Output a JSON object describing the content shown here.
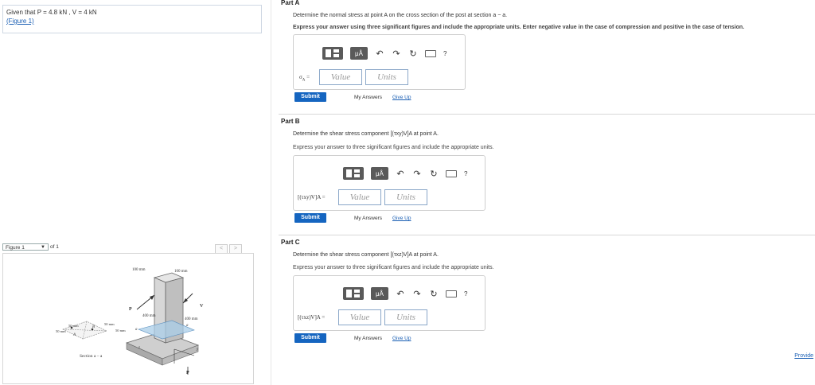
{
  "given": {
    "text_prefix": "Given that",
    "p_expr": "P = 4.8 kN , V = 4 kN",
    "figure_link": "(Figure 1)"
  },
  "parts": [
    {
      "title": "Part A",
      "question": "Determine the normal stress at point A on the cross section of the post at section a − a.",
      "instruction": "Express your answer using three significant figures and include the appropriate units. Enter negative value in the case of compression and positive in the case of tension.",
      "var_label": "σ",
      "var_sub": "A",
      "value_placeholder": "Value",
      "units_placeholder": "Units",
      "submit_label": "Submit",
      "my_answers": "My Answers",
      "give_up": "Give Up"
    },
    {
      "title": "Part B",
      "question": "Determine the shear stress component [(τxy)V]A at point A.",
      "instruction": "Express your answer to three significant figures and include the appropriate units.",
      "var_label": "[(τxy)V]A =",
      "value_placeholder": "Value",
      "units_placeholder": "Units",
      "submit_label": "Submit",
      "my_answers": "My Answers",
      "give_up": "Give Up"
    },
    {
      "title": "Part C",
      "question": "Determine the shear stress component [(τxz)V]A at point A.",
      "instruction": "Express your answer to three significant figures and include the appropriate units.",
      "var_label": "[(τxz)V]A =",
      "value_placeholder": "Value",
      "units_placeholder": "Units",
      "submit_label": "Submit",
      "my_answers": "My Answers",
      "give_up": "Give Up"
    }
  ],
  "toolbar": {
    "mu_label": "μÅ",
    "help_label": "?"
  },
  "figure_panel": {
    "selected": "Figure 1",
    "of_text": "of 1",
    "prev": "<",
    "next": ">",
    "labels": {
      "dim_top_left": "100 mm",
      "dim_top_right": "100 mm",
      "p_top": "P",
      "v_label": "V",
      "dim_400_left": "400 mm",
      "dim_400_right": "400 mm",
      "a_left": "a",
      "a_right": "a",
      "z_label": "z",
      "y_label": "y",
      "p_bottom": "P",
      "sec_50_a": "50 mm",
      "sec_50_b": "50 mm",
      "sec_50_c": "50 mm",
      "sec_50_d": "50 mm",
      "sec_a": "A",
      "sec_b": "B",
      "section_caption": "Section a – a"
    }
  },
  "provide_feedback": "Provide"
}
